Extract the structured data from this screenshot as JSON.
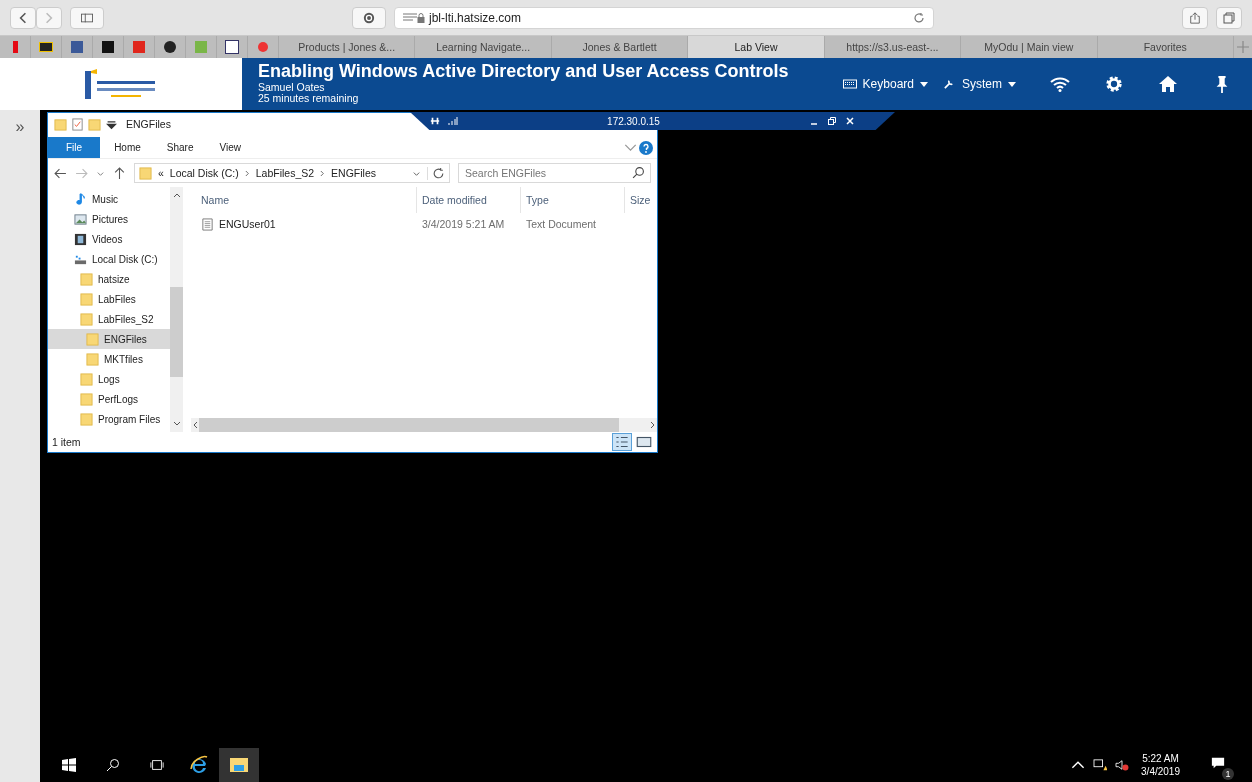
{
  "browser": {
    "address": "jbl-lti.hatsize.com",
    "tabs": [
      {
        "label": "Products | Jones &...",
        "selected": false
      },
      {
        "label": "Learning Navigate...",
        "selected": false
      },
      {
        "label": "Jones & Bartlett",
        "selected": false
      },
      {
        "label": "Lab View",
        "selected": true
      },
      {
        "label": "https://s3.us-east-...",
        "selected": false
      },
      {
        "label": "MyOdu | Main view",
        "selected": false
      },
      {
        "label": "Favorites",
        "selected": false
      }
    ]
  },
  "lab": {
    "title": "Enabling Windows Active Directory and User Access Controls",
    "user": "Samuel Oates",
    "remaining": "25 minutes remaining",
    "menus": [
      {
        "kind": "keyboard",
        "label": "Keyboard"
      },
      {
        "kind": "system",
        "label": "System"
      }
    ],
    "expand": "»"
  },
  "connection": {
    "address": "172.30.0.15"
  },
  "explorer": {
    "title": "ENGFiles",
    "ribbon_tabs": [
      {
        "label": "File",
        "selected": true
      },
      {
        "label": "Home",
        "selected": false
      },
      {
        "label": "Share",
        "selected": false
      },
      {
        "label": "View",
        "selected": false
      }
    ],
    "breadcrumb": {
      "overflow": "«",
      "parts": [
        "Local Disk (C:)",
        "LabFiles_S2",
        "ENGFiles"
      ]
    },
    "search": {
      "placeholder": "Search ENGFiles"
    },
    "nav": [
      {
        "kind": "music",
        "label": "Music",
        "selected": false
      },
      {
        "kind": "pictures",
        "label": "Pictures",
        "selected": false
      },
      {
        "kind": "videos",
        "label": "Videos",
        "selected": false
      },
      {
        "kind": "drive",
        "label": "Local Disk (C:)",
        "selected": false,
        "children": [
          {
            "kind": "folder",
            "label": "hatsize",
            "selected": false
          },
          {
            "kind": "folder",
            "label": "LabFiles",
            "selected": false
          },
          {
            "kind": "folder",
            "label": "LabFiles_S2",
            "selected": false,
            "children": [
              {
                "kind": "folder",
                "label": "ENGFiles",
                "selected": true
              },
              {
                "kind": "folder",
                "label": "MKTfiles",
                "selected": false
              }
            ]
          },
          {
            "kind": "folder",
            "label": "Logs",
            "selected": false
          },
          {
            "kind": "folder",
            "label": "PerfLogs",
            "selected": false
          },
          {
            "kind": "folder",
            "label": "Program Files",
            "selected": false
          }
        ]
      }
    ],
    "columns": [
      "Name",
      "Date modified",
      "Type",
      "Size"
    ],
    "rows": [
      {
        "name": "ENGUser01",
        "date": "3/4/2019 5:21 AM",
        "type": "Text Document"
      }
    ],
    "status": "1 item"
  },
  "taskbar": {
    "time": "5:22 AM",
    "date": "3/4/2019",
    "notifications": "1"
  }
}
